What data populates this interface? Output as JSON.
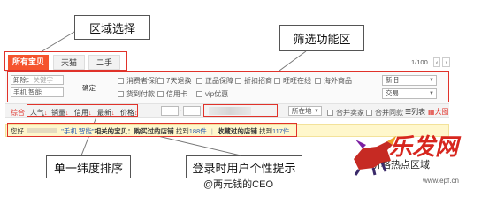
{
  "annotations": {
    "region_select": "区域选择",
    "filter_area": "筛选功能区",
    "single_sort": "单一纬度排序",
    "login_tip": "登录时用户个性提示",
    "price_hint": "价格热点区域"
  },
  "tabs": [
    {
      "label": "所有宝贝",
      "active": true
    },
    {
      "label": "天猫",
      "active": false
    },
    {
      "label": "二手",
      "active": false
    }
  ],
  "pager": {
    "text": "1/100",
    "prev": "‹",
    "next": "›"
  },
  "search": {
    "keyword_label": "卸除：",
    "keyword_placeholder": "关键字",
    "keyword_value": "手机 智能",
    "confirm_label": "确定"
  },
  "filters": {
    "row1": [
      "消费者保障",
      "7天退换",
      "正品保障",
      "折扣招商",
      "旺旺在线",
      "海外商品"
    ],
    "row2": [
      "货到付款",
      "信用卡",
      "vip优惠"
    ],
    "select_location": "新旧",
    "select_status": "交易"
  },
  "sortbar": {
    "items": [
      "综合",
      "人气",
      "销量",
      "信用",
      "最新",
      "价格"
    ],
    "location_label": "所在地",
    "merge_seller": "合并卖家",
    "merge_same": "合并同款",
    "list_view": "列表",
    "grid_view": "大图"
  },
  "tipbar": {
    "prefix": "您好",
    "query": "\"手机 智能\"",
    "middle": "相关的宝贝：购买过的店铺",
    "count1_pre": "找到",
    "count1": "188件",
    "sep": "|",
    "fav": "收藏过的店铺",
    "count2_pre": "找到",
    "count2": "117件"
  },
  "watermark": {
    "text": "@两元钱的CEO",
    "site": "www.epf.cn",
    "logo_text": "乐发网"
  },
  "colors": {
    "accent": "#f5532d",
    "annotation_red": "#e0322a",
    "tip_bg": "#fff7cc",
    "link_blue": "#2a5db0"
  }
}
